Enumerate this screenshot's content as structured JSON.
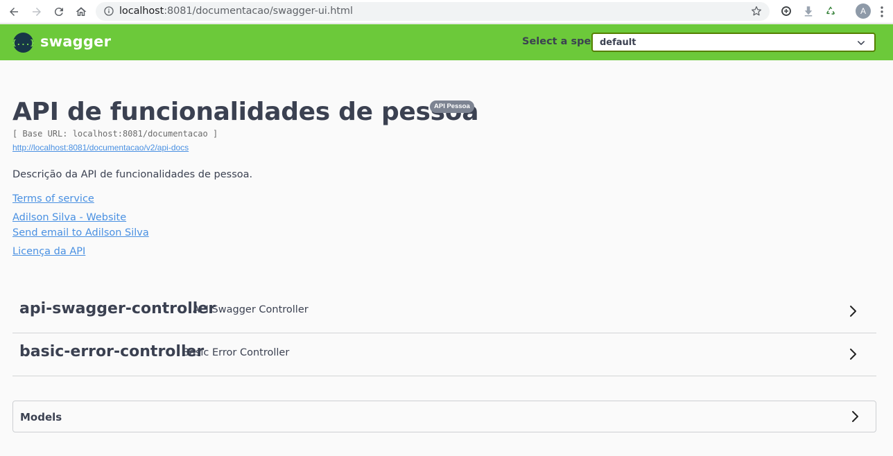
{
  "browser": {
    "url_host": "localhost",
    "url_path": ":8081/documentacao/swagger-ui.html",
    "avatar_letter": "A"
  },
  "topbar": {
    "logo_glyph": "{...}",
    "logo_text": "swagger",
    "spec_label": "Select a spec",
    "spec_value": "default",
    "brand_color": "#6cc93a"
  },
  "info": {
    "title": "API de funcionalidades de pessoa",
    "version_badge": "API Pessoa",
    "base_url": "[ Base URL: localhost:8081/documentacao ]",
    "api_docs_url": "http://localhost:8081/documentacao/v2/api-docs",
    "description": "Descrição da API de funcionalidades de pessoa.",
    "links": [
      "Terms of service",
      "Adilson Silva - Website",
      "Send email to Adilson Silva",
      "Licença da API"
    ]
  },
  "tags": [
    {
      "name": "api-swagger-controller",
      "description": "API Swagger Controller"
    },
    {
      "name": "basic-error-controller",
      "description": "Basic Error Controller"
    }
  ],
  "models": {
    "title": "Models"
  },
  "icons": {
    "back": "back-arrow-icon",
    "forward": "forward-arrow-icon",
    "reload": "reload-icon",
    "home": "home-icon",
    "info": "info-icon",
    "star": "star-icon",
    "chevron_right": "chevron-right-icon",
    "chevron_down": "chevron-down-icon"
  }
}
